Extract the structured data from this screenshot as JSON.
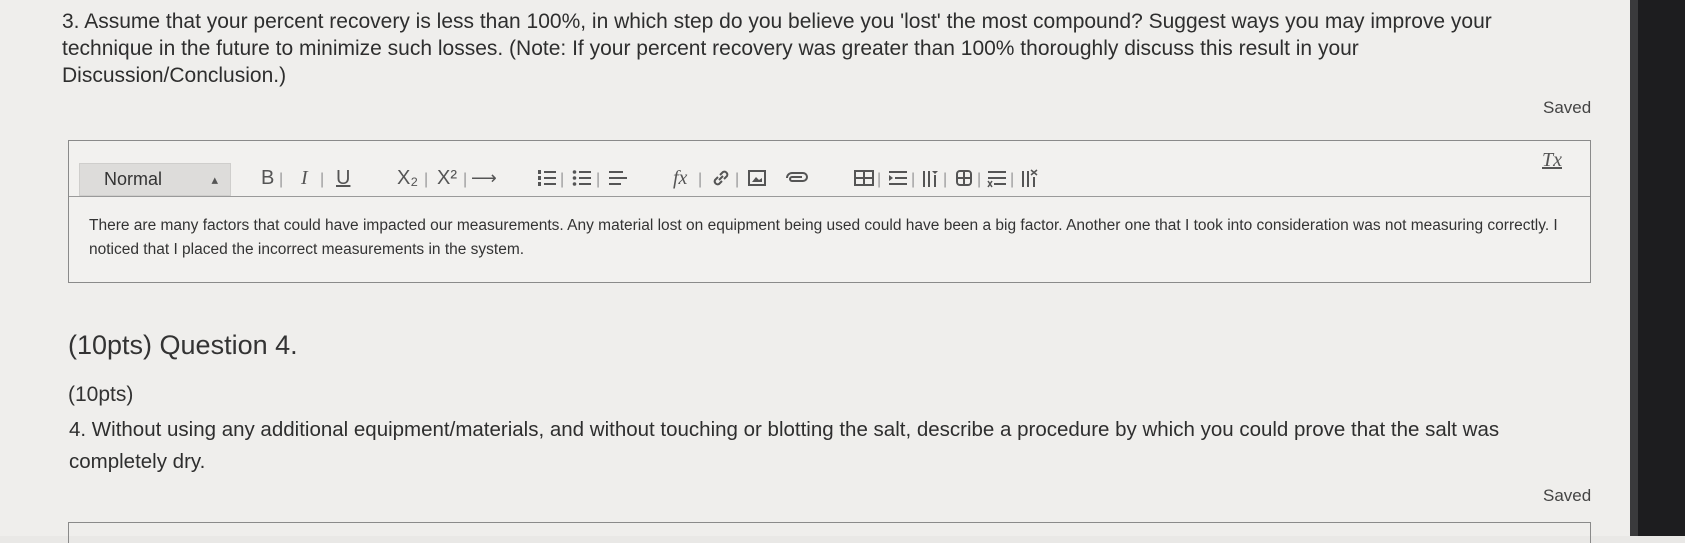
{
  "question3": {
    "text": "3. Assume that your percent recovery is less than 100%, in which step do you believe you 'lost' the most compound? Suggest ways you may improve your technique in the future to minimize such losses. (Note: If your percent recovery was greater than 100% thoroughly discuss this result in your Discussion/Conclusion.)",
    "saved_label": "Saved"
  },
  "editor": {
    "format_select": "Normal",
    "toolbar": {
      "bold": "B",
      "italic": "I",
      "underline": "U",
      "subscript": "X₂",
      "superscript": "X²",
      "arrow": "⟶",
      "formula": "fx",
      "clear_format": "Tx"
    },
    "content": "There are many factors that could have impacted our measurements. Any material lost on equipment being used could have been a big factor. Another one that I took into consideration was not measuring correctly. I noticed that I placed the incorrect measurements in the system."
  },
  "question4": {
    "heading": "(10pts) Question 4.",
    "points": "(10pts)",
    "text": "4. Without using any additional equipment/materials, and without touching or blotting the salt, describe a procedure by which you could prove that the salt was completely dry.",
    "saved_label": "Saved"
  }
}
